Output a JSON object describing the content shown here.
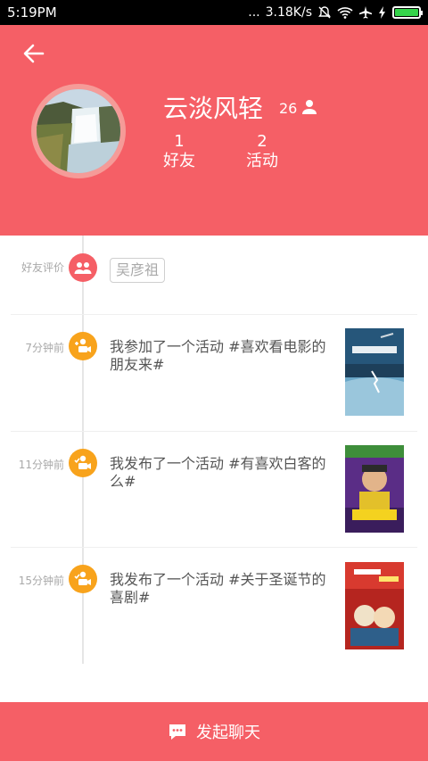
{
  "status_bar": {
    "time": "5:19PM",
    "dots": "...",
    "network_speed": "3.18K/s",
    "icons": [
      "mute-icon",
      "wifi-icon",
      "airplane-icon",
      "charging-icon",
      "battery-icon"
    ],
    "battery_level": 1.0
  },
  "profile": {
    "name": "云淡风轻",
    "follower_count": "26",
    "stats": [
      {
        "value": "1",
        "label": "好友"
      },
      {
        "value": "2",
        "label": "活动"
      }
    ]
  },
  "timeline": {
    "review": {
      "time": "好友评价",
      "tag": "吴彦祖"
    },
    "items": [
      {
        "time": "7分钟前",
        "text": "我参加了一个活动 #喜欢看电影的朋友来#"
      },
      {
        "time": "11分钟前",
        "text": "我发布了一个活动 #有喜欢白客的么#"
      },
      {
        "time": "15分钟前",
        "text": "我发布了一个活动 #关于圣诞节的喜剧#"
      }
    ]
  },
  "footer": {
    "button_label": "发起聊天"
  },
  "colors": {
    "accent": "#f55f66",
    "orange": "#f8a31c",
    "battery": "#35d34a"
  }
}
